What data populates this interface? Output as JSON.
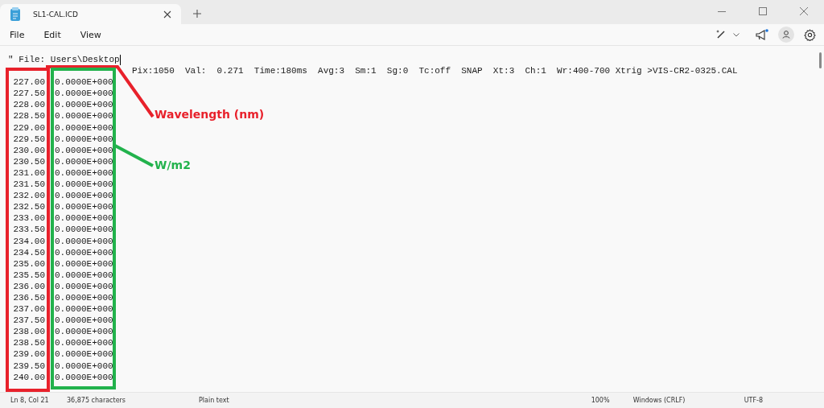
{
  "tab": {
    "title": "SL1-CAL.ICD",
    "selected": true
  },
  "menu": [
    "File",
    "Edit",
    "View"
  ],
  "editor": {
    "file_line": "\" File: Users\\Desktop",
    "header_visible": "Pix:1050  Val:  0.271  Time:180ms  Avg:3  Sm:1  Sg:0  Tc:off  SNAP  Xt:3  Ch:1  Wr:400-700 Xtrig >VIS-CR2-0325.CAL",
    "rows": [
      {
        "wavelength": "227.00",
        "value": "0.0000E+000"
      },
      {
        "wavelength": "227.50",
        "value": "0.0000E+000"
      },
      {
        "wavelength": "228.00",
        "value": "0.0000E+000"
      },
      {
        "wavelength": "228.50",
        "value": "0.0000E+000"
      },
      {
        "wavelength": "229.00",
        "value": "0.0000E+000"
      },
      {
        "wavelength": "229.50",
        "value": "0.0000E+000"
      },
      {
        "wavelength": "230.00",
        "value": "0.0000E+000"
      },
      {
        "wavelength": "230.50",
        "value": "0.0000E+000"
      },
      {
        "wavelength": "231.00",
        "value": "0.0000E+000"
      },
      {
        "wavelength": "231.50",
        "value": "0.0000E+000"
      },
      {
        "wavelength": "232.00",
        "value": "0.0000E+000"
      },
      {
        "wavelength": "232.50",
        "value": "0.0000E+000"
      },
      {
        "wavelength": "233.00",
        "value": "0.0000E+000"
      },
      {
        "wavelength": "233.50",
        "value": "0.0000E+000"
      },
      {
        "wavelength": "234.00",
        "value": "0.0000E+000"
      },
      {
        "wavelength": "234.50",
        "value": "0.0000E+000"
      },
      {
        "wavelength": "235.00",
        "value": "0.0000E+000"
      },
      {
        "wavelength": "235.50",
        "value": "0.0000E+000"
      },
      {
        "wavelength": "236.00",
        "value": "0.0000E+000"
      },
      {
        "wavelength": "236.50",
        "value": "0.0000E+000"
      },
      {
        "wavelength": "237.00",
        "value": "0.0000E+000"
      },
      {
        "wavelength": "237.50",
        "value": "0.0000E+000"
      },
      {
        "wavelength": "238.00",
        "value": "0.0000E+000"
      },
      {
        "wavelength": "238.50",
        "value": "0.0000E+000"
      },
      {
        "wavelength": "239.00",
        "value": "0.0000E+000"
      },
      {
        "wavelength": "239.50",
        "value": "0.0000E+000"
      },
      {
        "wavelength": "240.00",
        "value": "0.0000E+000"
      }
    ]
  },
  "annotations": [
    {
      "label": "Wavelength (nm)",
      "color": "#e8212b"
    },
    {
      "label": "W/m2",
      "color": "#22b24c"
    }
  ],
  "status_bar": {
    "position": "Ln 8, Col 21",
    "characters": "36,875 characters",
    "format": "Plain text",
    "zoom": "100%",
    "line_ending": "Windows (CRLF)",
    "encoding": "UTF-8"
  }
}
